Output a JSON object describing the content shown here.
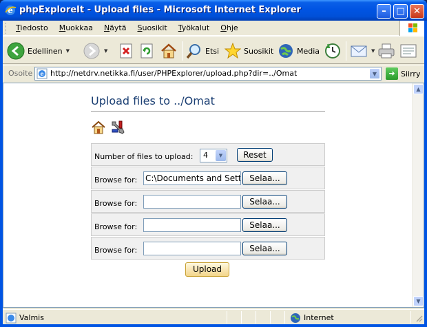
{
  "window": {
    "title": "phpExploreIt - Upload files - Microsoft Internet Explorer",
    "minimize": "–",
    "maximize": "□",
    "close": "✕"
  },
  "menu": {
    "items": [
      {
        "underline": "T",
        "rest": "iedosto"
      },
      {
        "underline": "M",
        "rest": "uokkaa"
      },
      {
        "underline": "N",
        "rest": "äytä"
      },
      {
        "underline": "S",
        "rest": "uosikit"
      },
      {
        "underline": "T",
        "rest": "yökalut"
      },
      {
        "underline": "O",
        "rest": "hje"
      }
    ]
  },
  "toolbar": {
    "back_label": "Edellinen",
    "search_label": "Etsi",
    "favorites_label": "Suosikit",
    "media_label": "Media"
  },
  "address": {
    "label": "Osoite",
    "url": "http://netdrv.netikka.fi/user/PHPExplorer/upload.php?dir=../Omat",
    "go_label": "Siirry"
  },
  "page": {
    "title": "Upload files to ../Omat",
    "num_files_label": "Number of files to upload:",
    "num_files_value": "4",
    "reset_label": "Reset",
    "browse_label": "Browse for:",
    "browse_button": "Selaa...",
    "files": [
      {
        "value": "C:\\Documents and Setti"
      },
      {
        "value": ""
      },
      {
        "value": ""
      },
      {
        "value": ""
      }
    ],
    "upload_label": "Upload"
  },
  "status": {
    "text": "Valmis",
    "zone": "Internet"
  },
  "colors": {
    "title_blue": "#1B3F73",
    "xp_titlebar": "#0054E3"
  }
}
